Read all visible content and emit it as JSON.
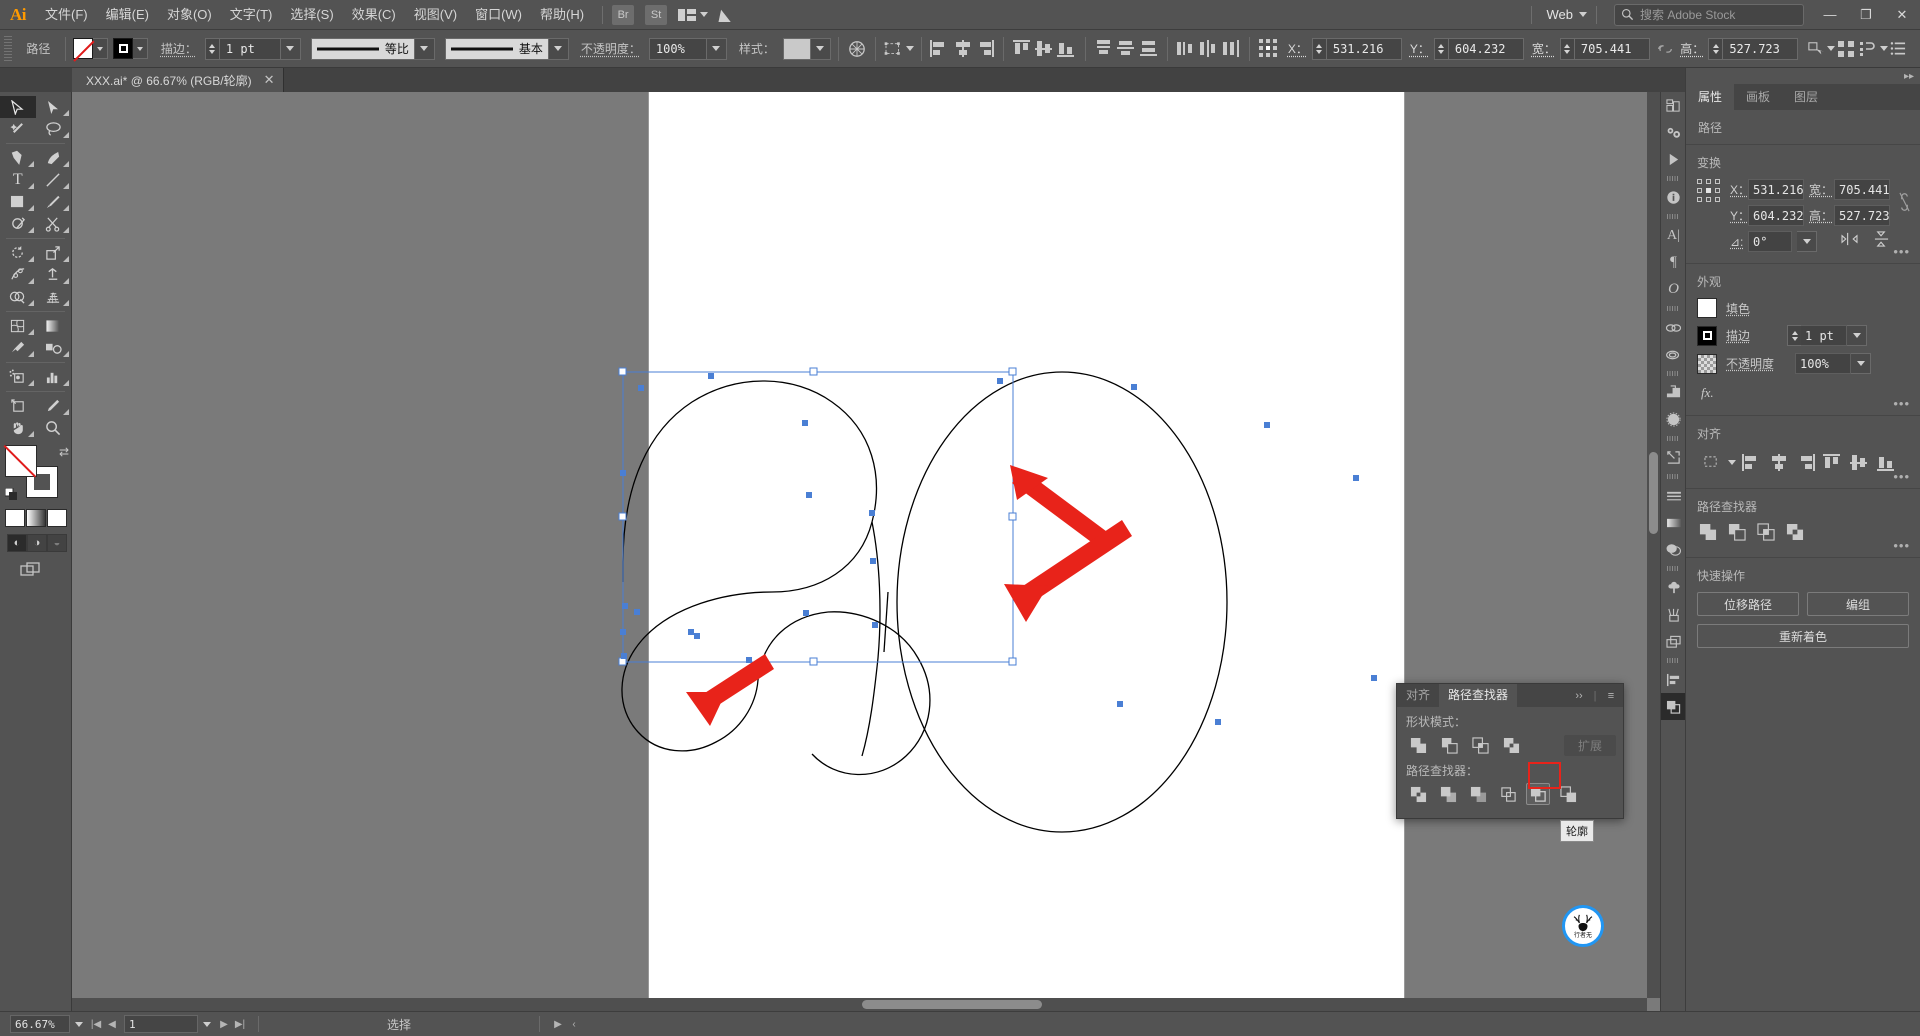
{
  "app": {
    "name": "Ai",
    "logo_text": "Ai"
  },
  "menu": {
    "items": [
      "文件(F)",
      "编辑(E)",
      "对象(O)",
      "文字(T)",
      "选择(S)",
      "效果(C)",
      "视图(V)",
      "窗口(W)",
      "帮助(H)"
    ],
    "app_buttons": [
      "Br",
      "St"
    ],
    "workspace_label": "Web",
    "search_placeholder": "搜索 Adobe Stock",
    "window_buttons": [
      "—",
      "❐",
      "✕"
    ]
  },
  "control_bar": {
    "object_label": "路径",
    "fill_swatch": "none-swatch",
    "stroke_swatch": "black-stroke-swatch",
    "stroke_label": "描边：",
    "stroke_weight": "1 pt",
    "stroke_profile": "等比",
    "brush_definition": "基本",
    "opacity_label": "不透明度：",
    "opacity_value": "100%",
    "style_label": "样式：",
    "x_label": "X：",
    "x_value": "531.216",
    "y_label": "Y：",
    "y_value": "604.232",
    "w_label": "宽：",
    "w_value": "705.441",
    "h_label": "高：",
    "h_value": "527.723"
  },
  "document_tab": {
    "title": "XXX.ai* @ 66.67% (RGB/轮廓)",
    "close": "✕"
  },
  "toolbar": {
    "tools": [
      "selection-tool",
      "direct-selection-tool",
      "magic-wand-tool",
      "lasso-tool",
      "pen-tool",
      "curvature-tool",
      "type-tool",
      "line-segment-tool",
      "rectangle-tool",
      "paintbrush-tool",
      "shaper-tool",
      "scissors-tool",
      "rotate-tool",
      "scale-tool",
      "width-tool",
      "free-transform-tool",
      "shape-builder-tool",
      "perspective-grid-tool",
      "mesh-tool",
      "gradient-tool",
      "eyedropper-tool",
      "blend-tool",
      "symbol-sprayer-tool",
      "column-graph-tool",
      "artboard-tool",
      "slice-tool",
      "hand-tool",
      "zoom-tool"
    ]
  },
  "properties_panel": {
    "tabs": [
      "属性",
      "画板",
      "图层"
    ],
    "active_tab": "属性",
    "subject": "路径",
    "transform": {
      "title": "变换",
      "x_label": "X：",
      "x_value": "531.216",
      "y_label": "Y：",
      "y_value": "604.232",
      "w_label": "宽：",
      "w_value": "705.441",
      "h_label": "高：",
      "h_value": "527.723",
      "angle_label": "⊿:",
      "angle_value": "0°",
      "dots": "•••"
    },
    "appearance": {
      "title": "外观",
      "fill_label": "填色",
      "stroke_label": "描边",
      "stroke_weight": "1 pt",
      "opacity_label": "不透明度",
      "opacity_value": "100%",
      "fx_label": "fx.",
      "dots": "•••"
    },
    "align": {
      "title": "对齐",
      "dots": "•••"
    },
    "pathfinder": {
      "title": "路径查找器",
      "dots": "•••"
    },
    "quick_actions": {
      "title": "快速操作",
      "offset_path": "位移路径",
      "group": "编组",
      "recolor": "重新着色"
    }
  },
  "pathfinder_panel": {
    "tabs": [
      "对齐",
      "路径查找器"
    ],
    "active_tab": "路径查找器",
    "shape_modes_label": "形状模式：",
    "pathfinder_label": "路径查找器：",
    "expand_button": "扩展",
    "shape_mode_buttons": [
      "unite",
      "minus-front",
      "intersect",
      "exclude"
    ],
    "pathfinder_buttons": [
      "divide",
      "trim",
      "merge",
      "crop",
      "outline",
      "minus-back"
    ],
    "highlighted_button": "outline",
    "tooltip": "轮廓",
    "overflow": "››",
    "menu": "≡"
  },
  "status_bar": {
    "zoom": "66.67%",
    "page": "1",
    "tool_status": "选择"
  },
  "canvas": {
    "artboard_background": "#ffffff",
    "canvas_background": "#7a7a7a",
    "selection_color": "#4a7fd4",
    "annotation_arrow_color": "#e8231a",
    "watermark_text": "行者无"
  },
  "colors": {
    "chrome": "#535353",
    "panel": "#535353",
    "darker": "#454545",
    "accent_red": "#e8231a",
    "orange_logo": "#ff9a00",
    "selection_blue": "#4a7fd4"
  }
}
